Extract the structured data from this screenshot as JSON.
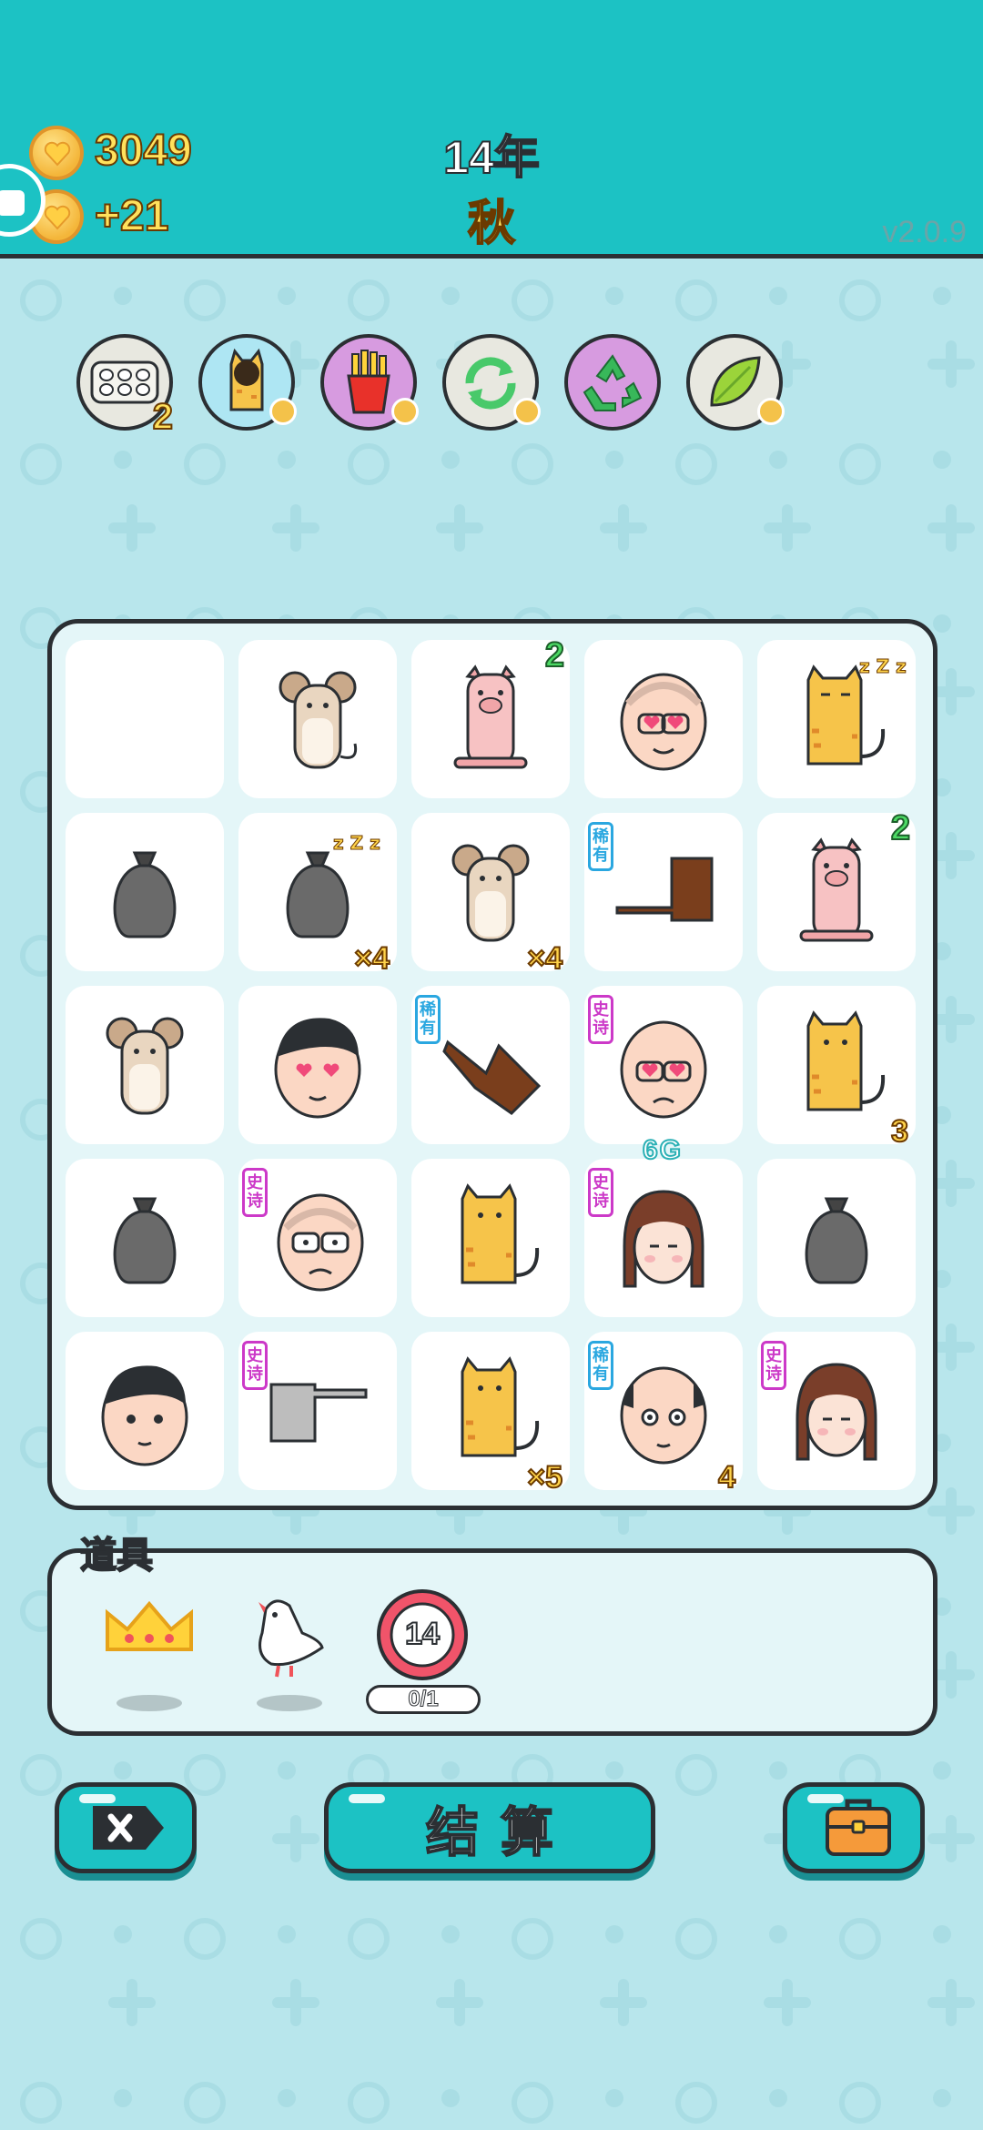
{
  "header": {
    "coins": "3049",
    "income": "+21",
    "year": "14年",
    "season": "秋",
    "version": "v2.0.9"
  },
  "buffs": [
    {
      "icon": "egg-carton-icon",
      "count": "2",
      "bg": "#e8e8e0"
    },
    {
      "icon": "cat-eating-icon",
      "bg": "#aee6f3"
    },
    {
      "icon": "french-fries-icon",
      "bg": "#d79be0"
    },
    {
      "icon": "refresh-icon",
      "bg": "#e8e8e0"
    },
    {
      "icon": "recycle-icon",
      "bg": "#d79be0"
    },
    {
      "icon": "leaf-icon",
      "bg": "#e8e8e0"
    }
  ],
  "board": {
    "rows": [
      [
        {
          "icon": "empty"
        },
        {
          "icon": "mouse-icon"
        },
        {
          "icon": "pig-icon",
          "top_right": "2"
        },
        {
          "icon": "old-man-heart-eyes-icon"
        },
        {
          "icon": "cat-sleeping-icon"
        }
      ],
      [
        {
          "icon": "trash-bag-icon"
        },
        {
          "icon": "trash-bag-sleeping-icon",
          "bottom_right": "×4"
        },
        {
          "icon": "mouse-icon",
          "bottom_right": "×4"
        },
        {
          "icon": "pointing-hand-brown-icon",
          "tag": "稀有",
          "tag_type": "rare"
        },
        {
          "icon": "pig-icon",
          "top_right": "2"
        }
      ],
      [
        {
          "icon": "mouse-icon"
        },
        {
          "icon": "man-heart-eyes-icon"
        },
        {
          "icon": "pointing-hand-diagonal-icon",
          "tag": "稀有",
          "tag_type": "rare"
        },
        {
          "icon": "bald-man-heart-eyes-icon",
          "tag": "史诗",
          "tag_type": "epic"
        },
        {
          "icon": "cat-icon",
          "bottom_right": "3"
        }
      ],
      [
        {
          "icon": "trash-bag-icon"
        },
        {
          "icon": "old-man-glasses-icon",
          "tag": "史诗",
          "tag_type": "epic"
        },
        {
          "icon": "cat-icon"
        },
        {
          "icon": "girl-braids-icon",
          "tag": "史诗",
          "tag_type": "epic",
          "top_label": "6G"
        },
        {
          "icon": "trash-bag-icon"
        }
      ],
      [
        {
          "icon": "man-face-icon"
        },
        {
          "icon": "pointing-hand-grey-icon",
          "tag": "史诗",
          "tag_type": "epic"
        },
        {
          "icon": "cat-icon",
          "bottom_right": "×5"
        },
        {
          "icon": "bald-man-icon",
          "tag": "稀有",
          "tag_type": "rare",
          "bottom_right": "4"
        },
        {
          "icon": "girl-braids-icon",
          "tag": "史诗",
          "tag_type": "epic"
        }
      ]
    ]
  },
  "items": {
    "title": "道具",
    "list": [
      {
        "icon": "crown-icon"
      },
      {
        "icon": "white-bird-icon"
      },
      {
        "icon": "speed-sign-icon",
        "value": "14",
        "counter": "0/1"
      }
    ]
  },
  "actions": {
    "cancel_icon": "close-tag-icon",
    "settle_label": "结算",
    "bag_icon": "briefcase-icon"
  }
}
